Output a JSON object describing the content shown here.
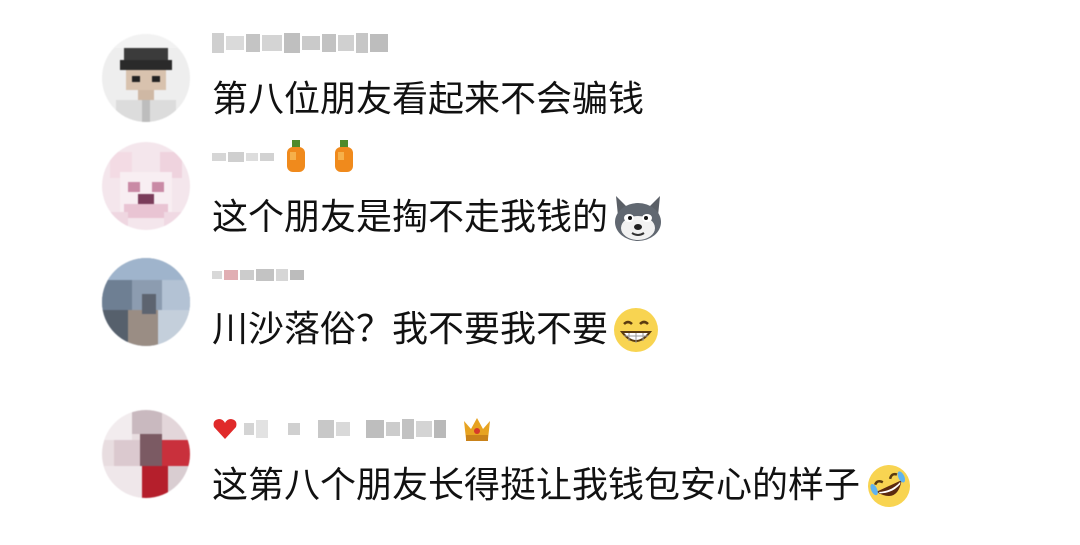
{
  "comments": [
    {
      "text": "第八位朋友看起来不会骗钱",
      "emoji": null
    },
    {
      "text": "这个朋友是掏不走我钱的",
      "emoji": "husky-dog-face-icon"
    },
    {
      "text": "川沙落俗？我不要我不要",
      "emoji": "grinning-face-icon"
    },
    {
      "text": "这第八个朋友长得挺让我钱包安心的样子",
      "emoji": "rolling-laughing-face-icon"
    }
  ],
  "name_decorations": {
    "comment_2": [
      "orange-icon",
      "orange-icon"
    ],
    "comment_4": [
      "heart-icon",
      "crown-icon"
    ]
  },
  "colors": {
    "text": "#111111",
    "pixelated_name": "#c9c9c9",
    "background": "#ffffff"
  }
}
